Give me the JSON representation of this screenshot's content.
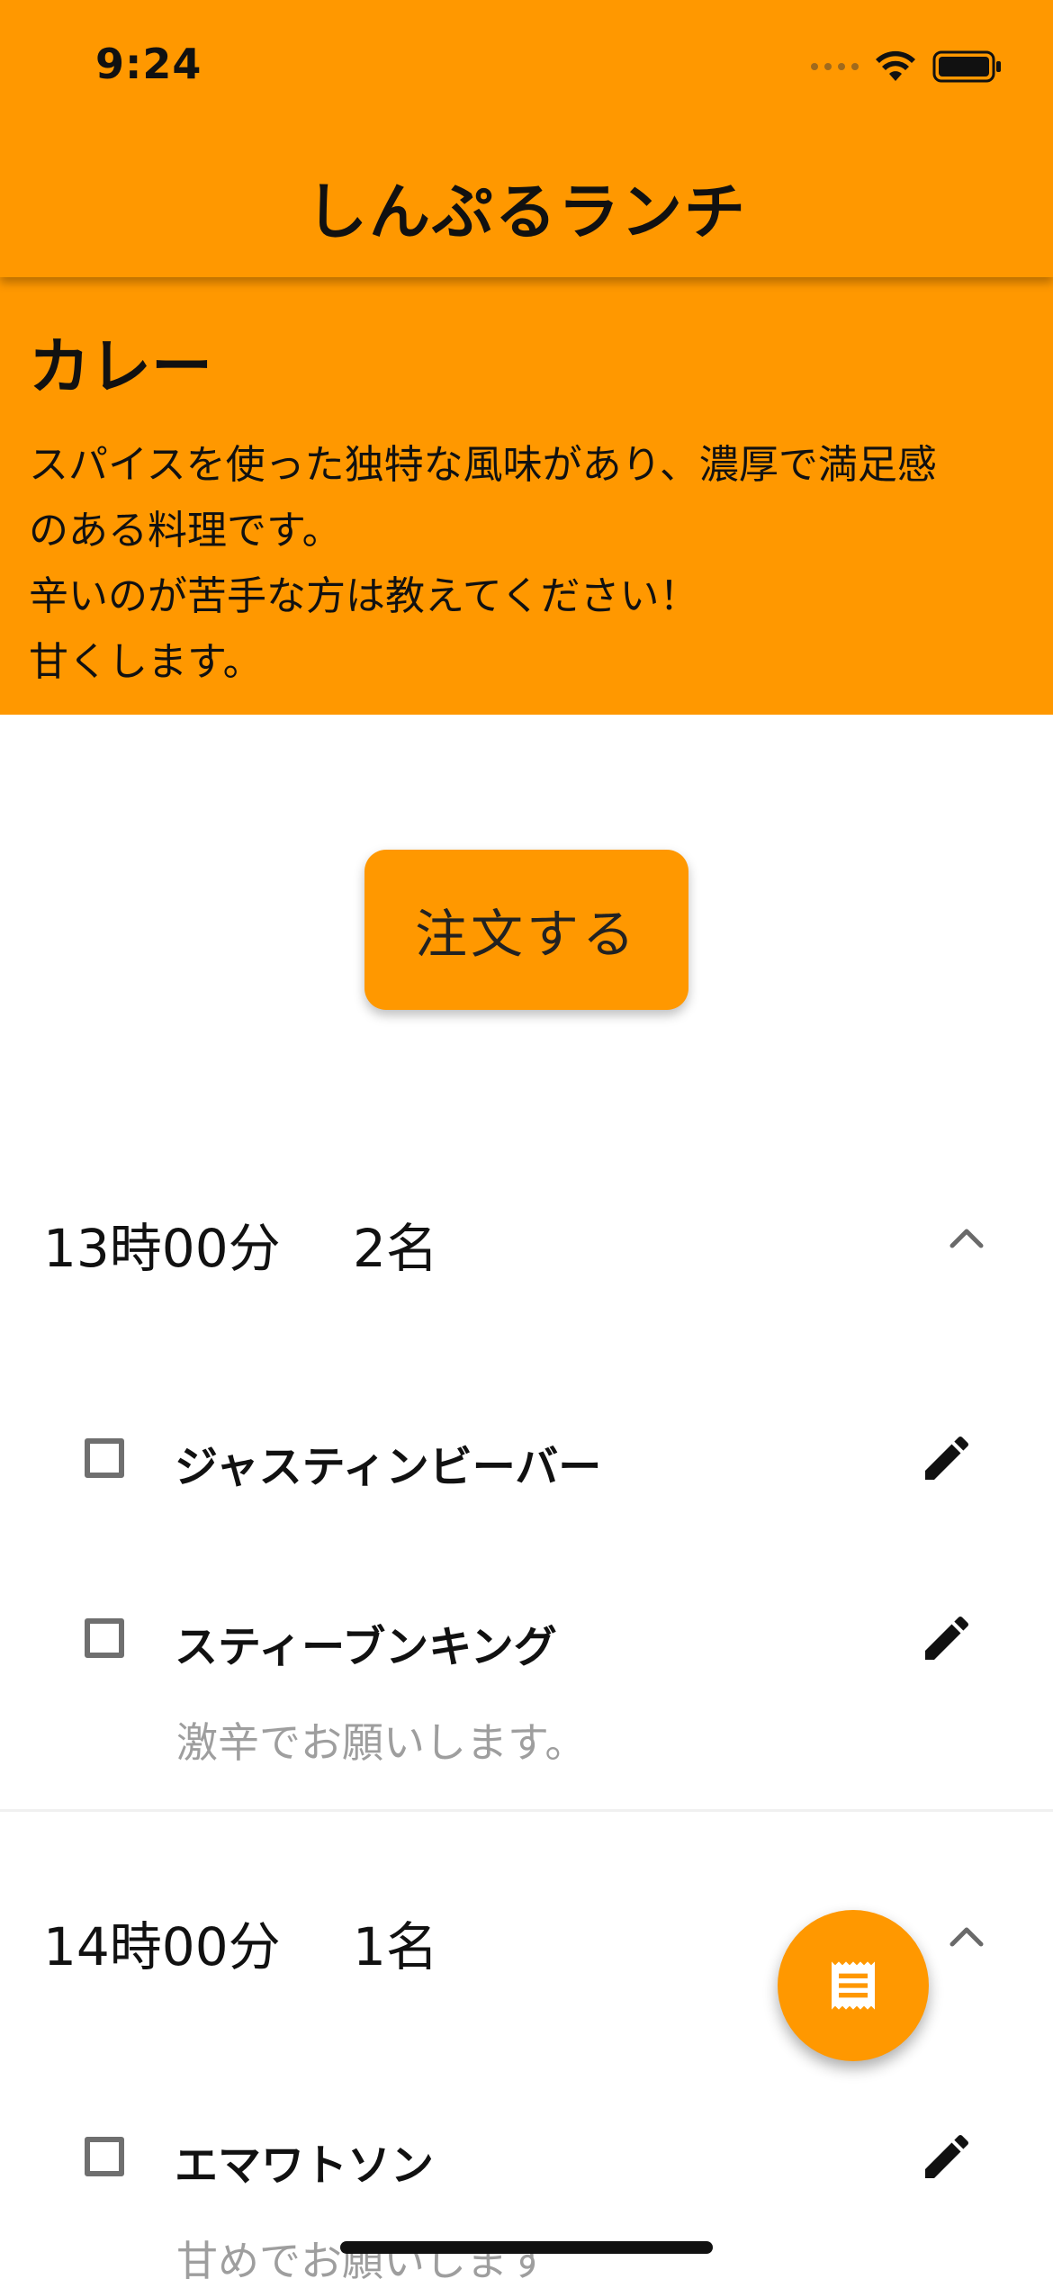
{
  "status_bar": {
    "time": "9:24"
  },
  "app_bar": {
    "title": "しんぷるランチ"
  },
  "menu": {
    "name": "カレー",
    "description": "スパイスを使った独特な風味があり、濃厚で満足感\nのある料理です。\n辛いのが苦手な方は教えてください！\n甘くします。"
  },
  "order_button": {
    "label": "注文する"
  },
  "groups": [
    {
      "time": "13時00分",
      "count": "2名",
      "people": [
        {
          "name": "ジャスティンビーバー",
          "note": ""
        },
        {
          "name": "スティーブンキング",
          "note": "激辛でお願いします。"
        }
      ]
    },
    {
      "time": "14時00分",
      "count": "1名",
      "people": [
        {
          "name": "エマワトソン",
          "note": "甘めでお願いします"
        }
      ]
    }
  ],
  "fab": {
    "icon": "receipt-icon"
  },
  "colors": {
    "accent": "#ff9800",
    "note_gray": "#9e9e9e"
  }
}
